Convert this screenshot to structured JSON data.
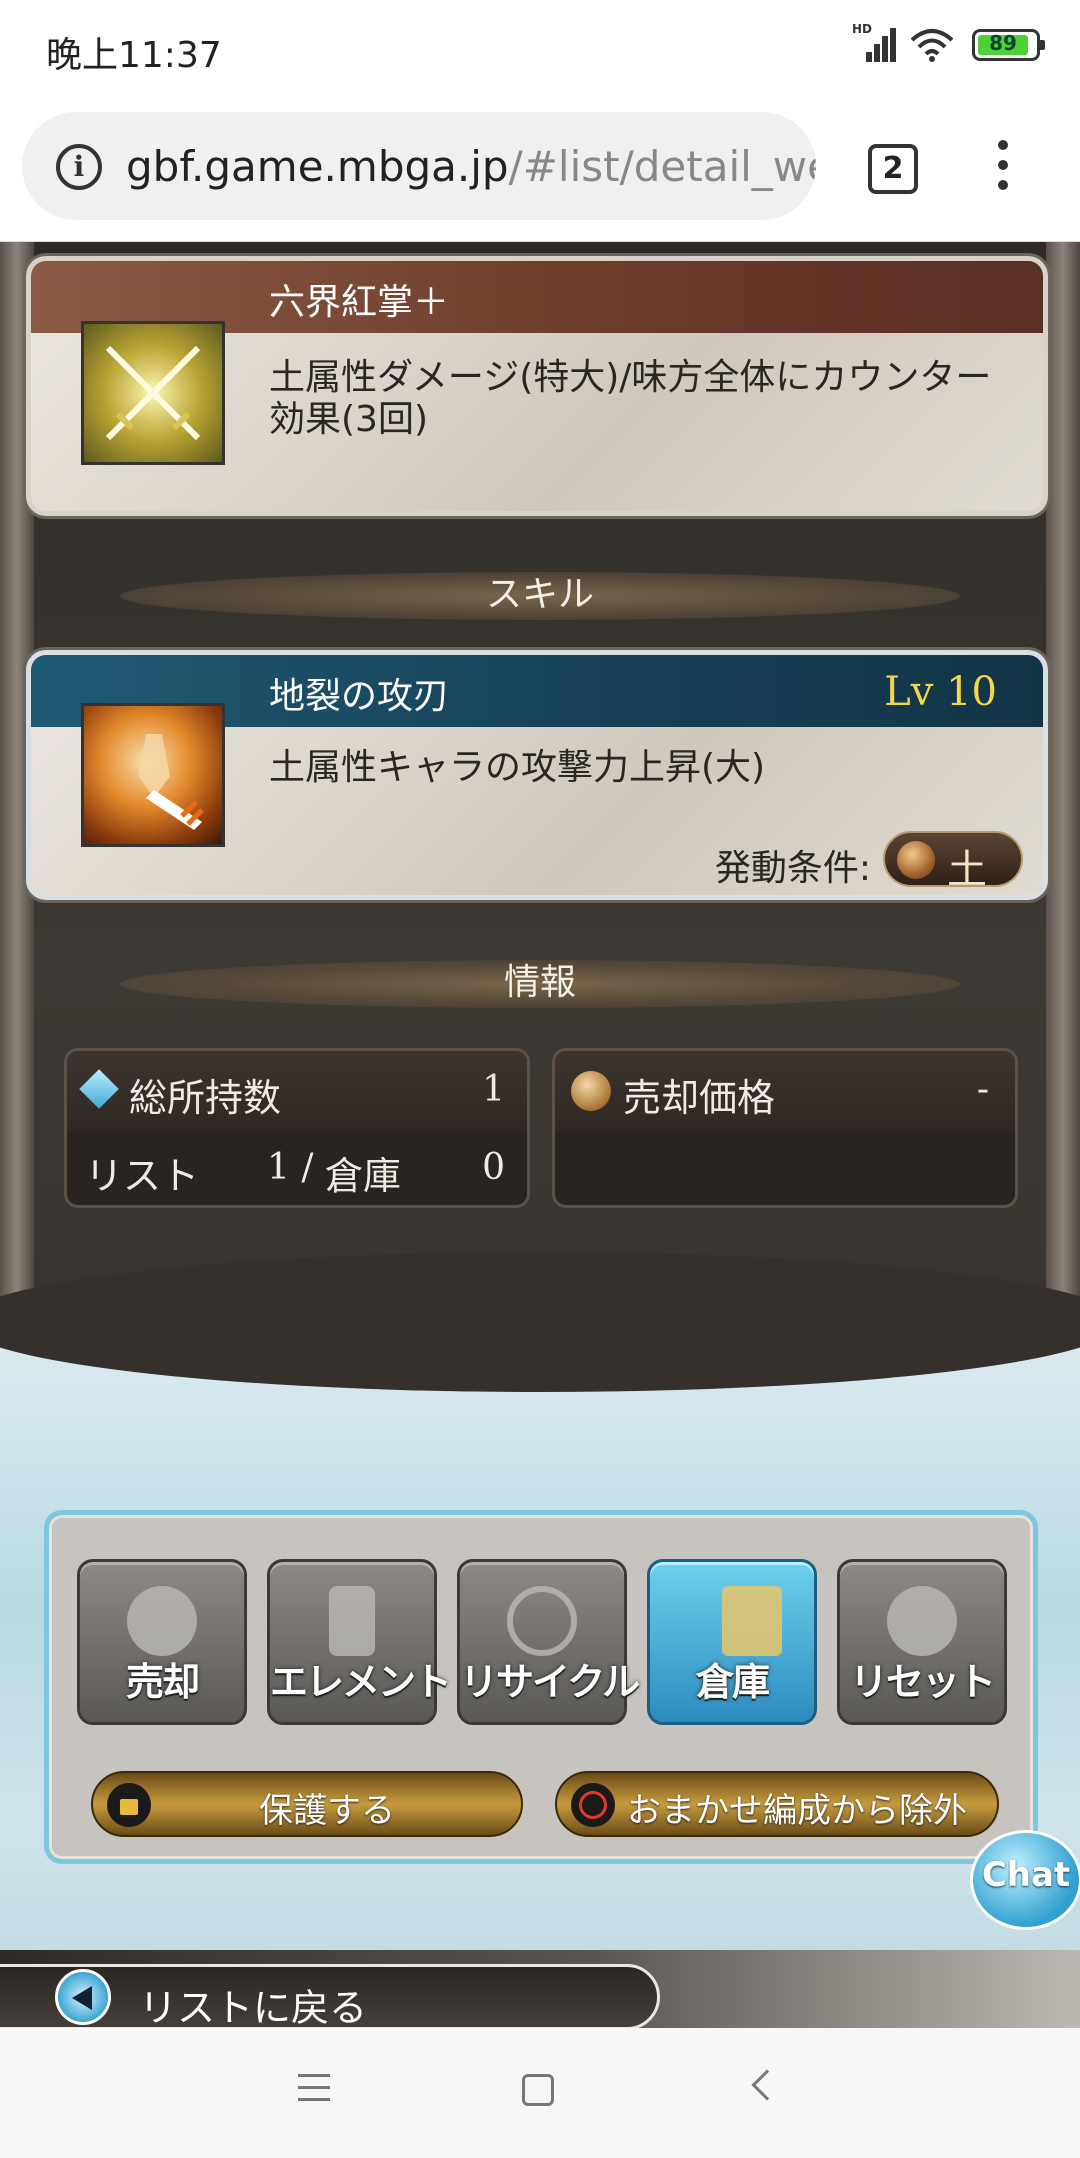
{
  "status_bar": {
    "time": "晚上11:37",
    "battery": "89"
  },
  "browser": {
    "url_host": "gbf.game.mbga.jp",
    "url_path": "/#list/detail_we",
    "tab_count": "2"
  },
  "ougi": {
    "name": "六界紅掌＋",
    "description": "土属性ダメージ(特大)/味方全体にカウンター効果(3回)"
  },
  "skill_section_title": "スキル",
  "skill": {
    "name": "地裂の攻刃",
    "level": "Lv 10",
    "description": "土属性キャラの攻撃力上昇(大)",
    "condition_label": "発動条件:",
    "condition_element": "土"
  },
  "info_section_title": "情報",
  "info": {
    "total_label": "総所持数",
    "total_value": "1",
    "list_label": "リスト",
    "list_value": "1 /",
    "storage_label": "倉庫",
    "storage_value": "0",
    "sell_label": "売却価格",
    "sell_value": "-"
  },
  "actions": [
    {
      "label": "売却",
      "icon": "sell-icon"
    },
    {
      "label": "エレメント",
      "icon": "element-icon"
    },
    {
      "label": "リサイクル",
      "icon": "recycle-icon"
    },
    {
      "label": "倉庫",
      "icon": "storage-icon"
    },
    {
      "label": "リセット",
      "icon": "reset-icon"
    }
  ],
  "protect_label": "保護する",
  "exclude_label": "おまかせ編成から除外",
  "back_label": "リストに戻る",
  "chat_label": "Chat",
  "colors": {
    "accent_blue": "#2c8cbf",
    "level_yellow": "#f2d64b",
    "gold": "#c79b3d"
  }
}
